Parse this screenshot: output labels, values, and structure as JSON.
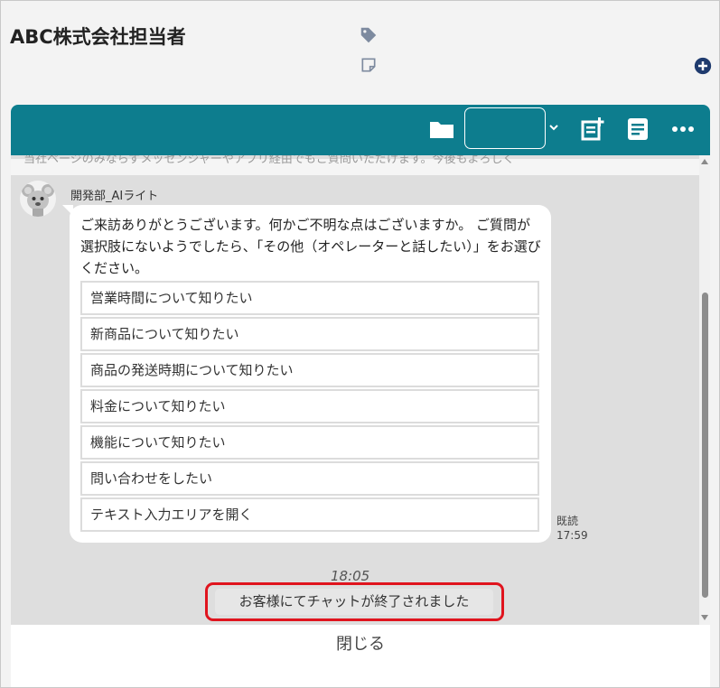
{
  "header": {
    "title": "ABC株式会社担当者",
    "tag_icon": "tag-icon",
    "note_icon": "note-icon",
    "add_icon": "plus-circle-icon"
  },
  "toolbar": {
    "color": "#0d7d8e",
    "select_value": "",
    "icons": [
      "folder-icon",
      "chevron-down-icon",
      "add-note-icon",
      "document-icon",
      "more-icon"
    ]
  },
  "chat": {
    "cut_text": "当社ページのみならずメッセンジャーやアプリ経由でもご質問いただけます。今後もよろしく",
    "bot_name": "開発部_AIライト",
    "message": "ご来訪ありがとうございます。何かご不明な点はございますか。 ご質問が選択肢にないようでしたら、「その他（オペレーターと話したい）」をお選びください。",
    "choices": [
      "営業時間について知りたい",
      "新商品について知りたい",
      "商品の発送時期について知りたい",
      "料金について知りたい",
      "機能について知りたい",
      "問い合わせをしたい",
      "テキスト入力エリアを開く"
    ],
    "read_label": "既読",
    "read_time": "17:59",
    "end_time": "18:05",
    "ended_message": "お客様にてチャットが終了されました",
    "highlight_color": "#e0141e"
  },
  "footer": {
    "close_label": "閉じる"
  }
}
